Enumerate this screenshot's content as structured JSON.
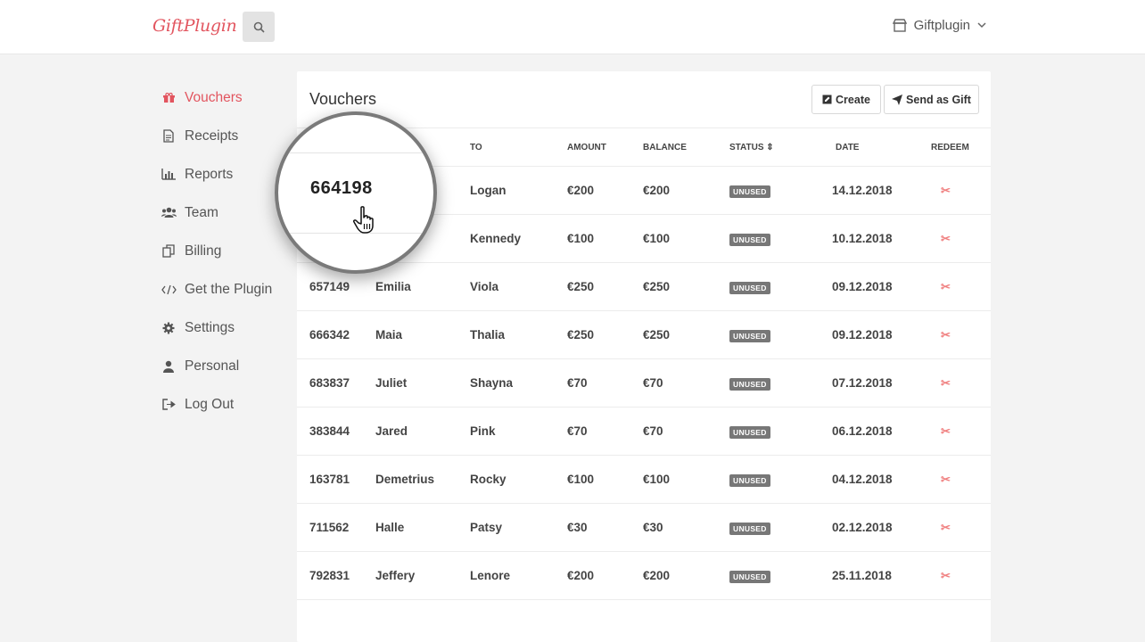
{
  "brand": {
    "logo": "GiftPlugin",
    "accent": "#e2555f"
  },
  "header": {
    "search_icon": "search-icon",
    "account_label": "Giftplugin"
  },
  "sidebar": {
    "items": [
      {
        "label": "Vouchers",
        "icon": "gift-icon",
        "active": true
      },
      {
        "label": "Receipts",
        "icon": "receipt-icon"
      },
      {
        "label": "Reports",
        "icon": "bar-chart-icon"
      },
      {
        "label": "Team",
        "icon": "team-icon"
      },
      {
        "label": "Billing",
        "icon": "billing-icon"
      },
      {
        "label": "Get the Plugin",
        "icon": "code-icon"
      },
      {
        "label": "Settings",
        "icon": "gear-icon"
      },
      {
        "label": "Personal",
        "icon": "user-icon"
      },
      {
        "label": "Log Out",
        "icon": "logout-icon"
      }
    ]
  },
  "main": {
    "title": "Vouchers",
    "create_label": "Create",
    "send_label": "Send as Gift",
    "columns": [
      "",
      "",
      "TO",
      "AMOUNT",
      "BALANCE",
      "STATUS ⇕",
      "DATE",
      "REDEEM"
    ],
    "rows": [
      {
        "id": "",
        "from": "",
        "to": "Logan",
        "amount": "€200",
        "balance": "€200",
        "status": "UNUSED",
        "date": "14.12.2018"
      },
      {
        "id": "",
        "from": "",
        "to": "Kennedy",
        "amount": "€100",
        "balance": "€100",
        "status": "UNUSED",
        "date": "10.12.2018"
      },
      {
        "id": "657149",
        "from": "Emilia",
        "to": "Viola",
        "amount": "€250",
        "balance": "€250",
        "status": "UNUSED",
        "date": "09.12.2018"
      },
      {
        "id": "666342",
        "from": "Maia",
        "to": "Thalia",
        "amount": "€250",
        "balance": "€250",
        "status": "UNUSED",
        "date": "09.12.2018"
      },
      {
        "id": "683837",
        "from": "Juliet",
        "to": "Shayna",
        "amount": "€70",
        "balance": "€70",
        "status": "UNUSED",
        "date": "07.12.2018"
      },
      {
        "id": "383844",
        "from": "Jared",
        "to": "Pink",
        "amount": "€70",
        "balance": "€70",
        "status": "UNUSED",
        "date": "06.12.2018"
      },
      {
        "id": "163781",
        "from": "Demetrius",
        "to": "Rocky",
        "amount": "€100",
        "balance": "€100",
        "status": "UNUSED",
        "date": "04.12.2018"
      },
      {
        "id": "711562",
        "from": "Halle",
        "to": "Patsy",
        "amount": "€30",
        "balance": "€30",
        "status": "UNUSED",
        "date": "02.12.2018"
      },
      {
        "id": "792831",
        "from": "Jeffery",
        "to": "Lenore",
        "amount": "€200",
        "balance": "€200",
        "status": "UNUSED",
        "date": "25.11.2018"
      }
    ]
  },
  "magnifier": {
    "voucher_id": "664198"
  }
}
